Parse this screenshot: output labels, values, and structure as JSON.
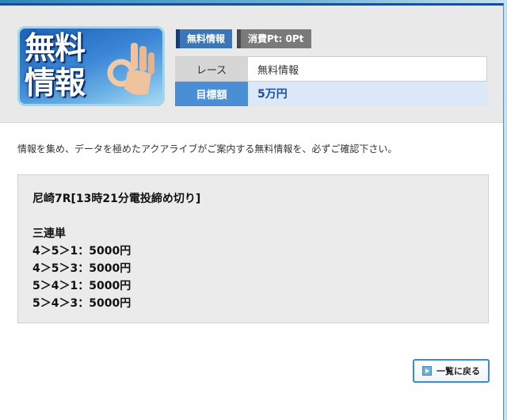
{
  "banner": {
    "line1": "無料",
    "line2": "情報"
  },
  "tags": {
    "free": "無料情報",
    "points": "消費Pt: 0Pt"
  },
  "info": {
    "race_label": "レース",
    "race_value": "無料情報",
    "target_label": "目標額",
    "target_value": "5万円"
  },
  "intro_text": "情報を集め、データを極めたアクアライブがご案内する無料情報を、必ずご確認下さい。",
  "tip": {
    "race": "尼崎7R[13時21分電投締め切り]",
    "bet_type": "三連単",
    "picks": [
      "4＞5＞1：5000円",
      "4＞5＞3：5000円",
      "5＞4＞1：5000円",
      "5＞4＞3：5000円"
    ]
  },
  "buttons": {
    "back": "一覧に戻る"
  },
  "colors": {
    "accent": "#3a8bd0",
    "header_border": "#1c4e93",
    "target_bg": "#dce8f7"
  },
  "icons": {
    "back": "arrow-right-icon",
    "banner": "ok-hand-icon"
  }
}
